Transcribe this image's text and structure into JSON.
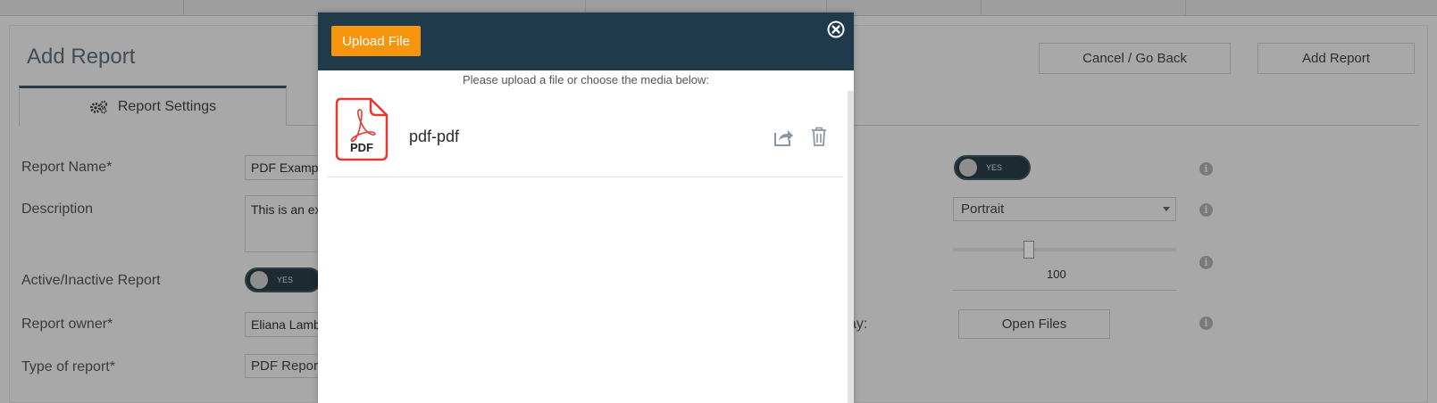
{
  "page": {
    "title": "Add Report",
    "cancel_label": "Cancel / Go Back",
    "add_label": "Add Report"
  },
  "tabs": [
    {
      "label": "Report Settings",
      "icon": "gears-icon"
    }
  ],
  "form": {
    "report_name_label": "Report Name*",
    "report_name_value": "PDF Example",
    "description_label": "Description",
    "description_value": "This is an ex",
    "active_label": "Active/Inactive Report",
    "active_toggle": "YES",
    "owner_label": "Report owner*",
    "owner_value": "Eliana Lamb",
    "type_label": "Type of report*",
    "type_value": "PDF Report"
  },
  "right_panel": {
    "toggle_text": "YES",
    "orientation_value": "Portrait",
    "slider_value": "100",
    "partial_label": "ay:",
    "open_files_label": "Open Files"
  },
  "modal": {
    "upload_label": "Upload File",
    "hint": "Please upload a file or choose the media below:",
    "items": [
      {
        "name": "pdf-pdf",
        "icon_text": "PDF"
      }
    ]
  },
  "colors": {
    "modal_header": "#1f3a4a",
    "upload_button": "#f7950f",
    "pdf_red": "#e53935"
  }
}
